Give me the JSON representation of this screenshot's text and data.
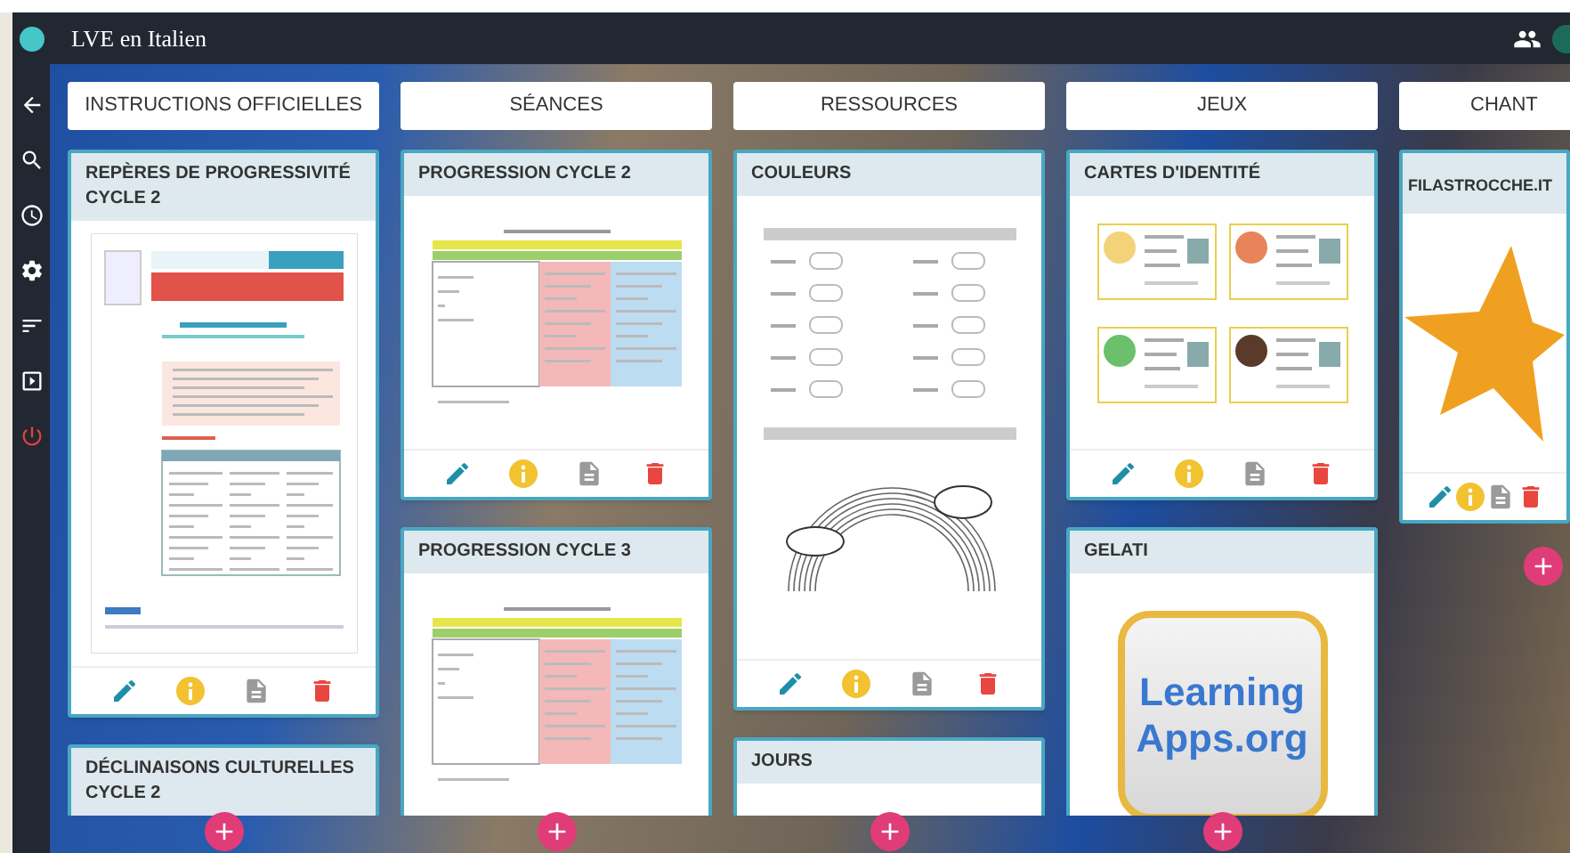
{
  "board": {
    "title": "LVE en Italien"
  },
  "columns": [
    {
      "title": "INSTRUCTIONS OFFICIELLES",
      "cards": [
        {
          "title": "REPÈRES DE PROGRESSIVITÉ CYCLE 2",
          "kind": "official-doc"
        },
        {
          "title": "DÉCLINAISONS CULTURELLES CYCLE 2",
          "kind": "official-doc"
        }
      ]
    },
    {
      "title": "SÉANCES",
      "cards": [
        {
          "title": "PROGRESSION CYCLE 2",
          "kind": "table-doc"
        },
        {
          "title": "PROGRESSION CYCLE 3",
          "kind": "table-doc"
        }
      ]
    },
    {
      "title": "RESSOURCES",
      "cards": [
        {
          "title": "COULEURS",
          "kind": "worksheet"
        },
        {
          "title": "JOURS",
          "kind": "worksheet"
        }
      ]
    },
    {
      "title": "JEUX",
      "cards": [
        {
          "title": "CARTES D'IDENTITÉ",
          "kind": "id-cards"
        },
        {
          "title": "GELATI",
          "kind": "logo",
          "logo_lines": [
            "Learning",
            "Apps.org"
          ]
        }
      ]
    },
    {
      "title": "CHANT",
      "cards": [
        {
          "title": "FILASTROCCHE.IT",
          "kind": "star"
        }
      ]
    }
  ]
}
